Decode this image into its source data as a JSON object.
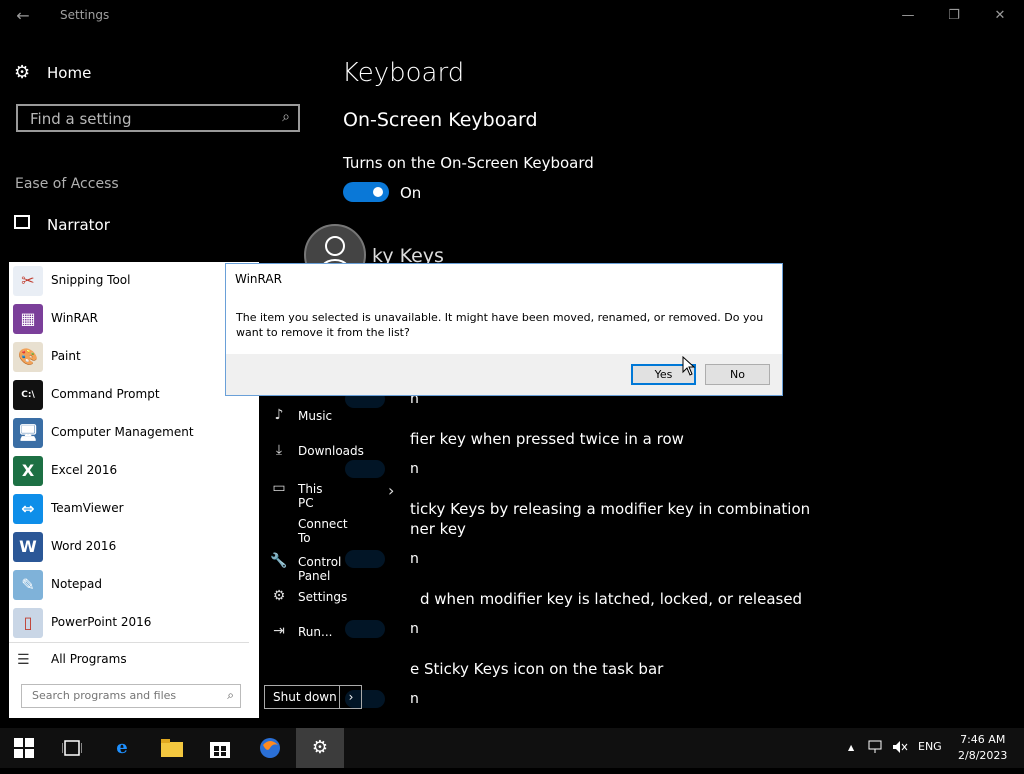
{
  "window": {
    "back": "←",
    "title": "Settings",
    "minimize": "—",
    "maximize": "❐",
    "close": "✕"
  },
  "sidebar": {
    "home_icon": "gear-icon",
    "home_label": "Home",
    "search_placeholder": "Find a setting",
    "section": "Ease of Access",
    "narrator_label": "Narrator"
  },
  "main": {
    "title": "Keyboard",
    "subtitle": "On-Screen Keyboard",
    "osk_desc": "Turns on the On-Screen Keyboard",
    "osk_state": "On",
    "sticky_heading": "ky Keys",
    "bg_on": "n",
    "bg_texts": [
      "fier key when pressed twice in a row",
      "ticky Keys by releasing a modifier key in combination",
      "ner key",
      "d when modifier key is latched, locked, or released",
      "e Sticky Keys icon on the task bar"
    ]
  },
  "start_menu": {
    "programs": [
      {
        "label": "Snipping Tool",
        "icon": "snipping-tool-icon",
        "glyph": "✂",
        "color": "#e9eef5"
      },
      {
        "label": "WinRAR",
        "icon": "winrar-icon",
        "glyph": "▦",
        "color": "#7b3f9a"
      },
      {
        "label": "Paint",
        "icon": "paint-icon",
        "glyph": "🎨",
        "color": "#e8e0d0"
      },
      {
        "label": "Command Prompt",
        "icon": "command-prompt-icon",
        "glyph": "C:\\",
        "color": "#111111"
      },
      {
        "label": "Computer Management",
        "icon": "computer-management-icon",
        "glyph": "🖥",
        "color": "#3a6ea5"
      },
      {
        "label": "Excel 2016",
        "icon": "excel-icon",
        "glyph": "X",
        "color": "#1d7044"
      },
      {
        "label": "TeamViewer",
        "icon": "teamviewer-icon",
        "glyph": "⇔",
        "color": "#0e8ee9"
      },
      {
        "label": "Word 2016",
        "icon": "word-icon",
        "glyph": "W",
        "color": "#2b5797"
      },
      {
        "label": "Notepad",
        "icon": "notepad-icon",
        "glyph": "✎",
        "color": "#7fb2d9"
      },
      {
        "label": "PowerPoint 2016",
        "icon": "powerpoint-icon",
        "glyph": "▯",
        "color": "#c9d6e6"
      }
    ],
    "all_programs": "All Programs",
    "search_placeholder": "Search programs and files",
    "right_items": [
      {
        "label": "Music",
        "icon": "music-icon",
        "glyph": "♪"
      },
      {
        "label": "Downloads",
        "icon": "downloads-icon",
        "glyph": "⤓"
      },
      {
        "label": "This PC",
        "icon": "this-pc-icon",
        "glyph": "▭"
      },
      {
        "label": "Connect To",
        "icon": "connect-to-icon",
        "glyph": ""
      },
      {
        "label": "Control Panel",
        "icon": "control-panel-icon",
        "glyph": "🔧"
      },
      {
        "label": "Settings",
        "icon": "settings-icon",
        "glyph": "⚙"
      },
      {
        "label": "Run...",
        "icon": "run-icon",
        "glyph": "⇥"
      }
    ],
    "this_pc_arrow": "›",
    "shutdown": "Shut down",
    "shutdown_arrow": "›"
  },
  "dialog": {
    "title": "WinRAR",
    "message": "The item you selected is unavailable.  It might have been moved, renamed, or removed.  Do you want to remove it from the list?",
    "yes": "Yes",
    "no": "No"
  },
  "taskbar": {
    "start_icon": "windows-icon",
    "clock_time": "7:46 AM",
    "clock_date": "2/8/2023",
    "lang": "ENG",
    "tray_up": "▲"
  }
}
